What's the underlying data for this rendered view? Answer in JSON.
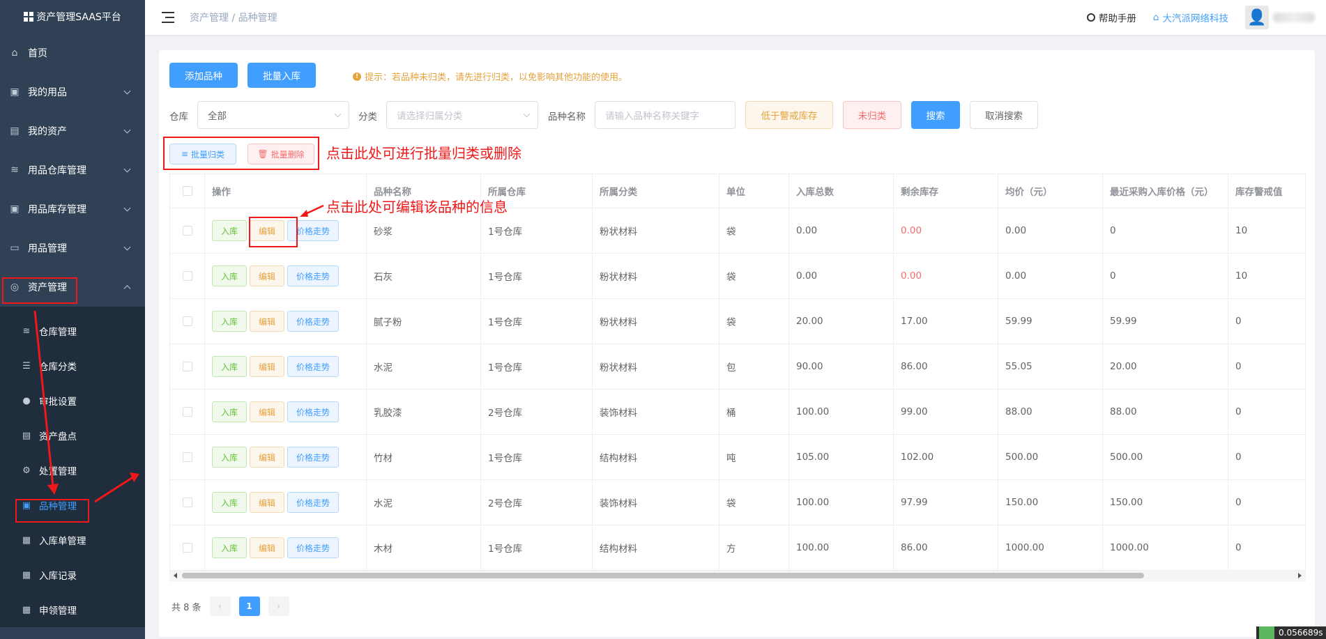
{
  "app": {
    "title": "资产管理SAAS平台"
  },
  "sidebar": {
    "items": [
      {
        "label": "首页",
        "icon": "home-icon"
      },
      {
        "label": "我的用品",
        "icon": "bag-icon"
      },
      {
        "label": "我的资产",
        "icon": "building-icon"
      },
      {
        "label": "用品仓库管理",
        "icon": "database-icon"
      },
      {
        "label": "用品库存管理",
        "icon": "box-icon"
      },
      {
        "label": "用品管理",
        "icon": "tray-icon"
      },
      {
        "label": "资产管理",
        "icon": "asset-icon"
      }
    ],
    "sub_items": [
      {
        "label": "仓库管理",
        "icon": "database-icon"
      },
      {
        "label": "仓库分类",
        "icon": "sliders-icon"
      },
      {
        "label": "审批设置",
        "icon": "user-icon"
      },
      {
        "label": "资产盘点",
        "icon": "document-icon"
      },
      {
        "label": "处置管理",
        "icon": "gear-icon"
      },
      {
        "label": "品种管理",
        "icon": "bag-icon"
      },
      {
        "label": "入库单管理",
        "icon": "clipboard-icon"
      },
      {
        "label": "入库记录",
        "icon": "clipboard-icon"
      },
      {
        "label": "申领管理",
        "icon": "clipboard-icon"
      }
    ]
  },
  "header": {
    "breadcrumb": {
      "parent": "资产管理",
      "sep": "/",
      "current": "品种管理"
    },
    "help": "帮助手册",
    "company": "大汽派网络科技"
  },
  "toolbar": {
    "add": "添加品种",
    "batch_in": "批量入库",
    "tip": "提示：若品种未归类，请先进行归类，以免影响其他功能的使用。"
  },
  "filters": {
    "warehouse_label": "仓库",
    "warehouse_value": "全部",
    "category_label": "分类",
    "category_placeholder": "请选择归属分类",
    "name_label": "品种名称",
    "name_placeholder": "请输入品种名称关键字",
    "low_stock": "低于警戒库存",
    "uncategorized": "未归类",
    "search": "搜索",
    "cancel": "取消搜索"
  },
  "batch": {
    "classify": "批量归类",
    "delete": "批量删除"
  },
  "annotations": {
    "batch": "点击此处可进行批量归类或删除",
    "edit": "点击此处可编辑该品种的信息"
  },
  "table": {
    "columns": [
      "操作",
      "品种名称",
      "所属仓库",
      "所属分类",
      "单位",
      "入库总数",
      "剩余库存",
      "均价（元）",
      "最近采购入库价格（元）",
      "库存警戒值"
    ],
    "actions": {
      "in": "入库",
      "edit": "编辑",
      "trend": "价格走势"
    },
    "rows": [
      {
        "name": "砂浆",
        "warehouse": "1号仓库",
        "category": "粉状材料",
        "unit": "袋",
        "total": "0.00",
        "stock": "0.00",
        "avg": "0.00",
        "last": "0",
        "alert": "10",
        "stock_red": true
      },
      {
        "name": "石灰",
        "warehouse": "1号仓库",
        "category": "粉状材料",
        "unit": "袋",
        "total": "0.00",
        "stock": "0.00",
        "avg": "0.00",
        "last": "0",
        "alert": "10",
        "stock_red": true
      },
      {
        "name": "腻子粉",
        "warehouse": "1号仓库",
        "category": "粉状材料",
        "unit": "袋",
        "total": "20.00",
        "stock": "17.00",
        "avg": "59.99",
        "last": "59.99",
        "alert": "0",
        "stock_red": false
      },
      {
        "name": "水泥",
        "warehouse": "1号仓库",
        "category": "粉状材料",
        "unit": "包",
        "total": "90.00",
        "stock": "86.00",
        "avg": "55.05",
        "last": "20.00",
        "alert": "0",
        "stock_red": false
      },
      {
        "name": "乳胶漆",
        "warehouse": "2号仓库",
        "category": "装饰材料",
        "unit": "桶",
        "total": "100.00",
        "stock": "99.00",
        "avg": "88.00",
        "last": "88.00",
        "alert": "0",
        "stock_red": false
      },
      {
        "name": "竹材",
        "warehouse": "1号仓库",
        "category": "结构材料",
        "unit": "吨",
        "total": "105.00",
        "stock": "102.00",
        "avg": "500.00",
        "last": "500.00",
        "alert": "0",
        "stock_red": false
      },
      {
        "name": "水泥",
        "warehouse": "2号仓库",
        "category": "装饰材料",
        "unit": "袋",
        "total": "100.00",
        "stock": "97.99",
        "avg": "150.00",
        "last": "150.00",
        "alert": "0",
        "stock_red": false
      },
      {
        "name": "木材",
        "warehouse": "1号仓库",
        "category": "结构材料",
        "unit": "方",
        "total": "100.00",
        "stock": "86.00",
        "avg": "1000.00",
        "last": "1000.00",
        "alert": "0",
        "stock_red": false
      }
    ]
  },
  "pagination": {
    "total": "共 8 条",
    "current": "1"
  },
  "corner": "0.056689s",
  "colors": {
    "sidebar_bg": "#304156",
    "primary": "#409eff",
    "annotation": "#f01818"
  }
}
